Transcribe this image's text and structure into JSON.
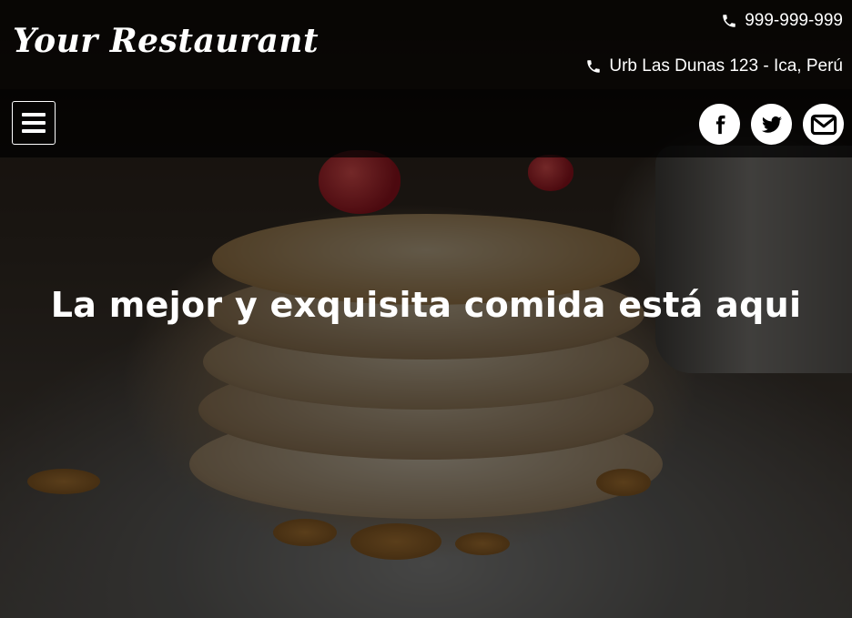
{
  "header": {
    "logo_text": "Your Restaurant",
    "phone": "999-999-999",
    "address": "Urb Las Dunas 123 - Ica, Perú",
    "phone_icon": "phone-icon"
  },
  "nav": {
    "menu_icon": "hamburger-menu-icon",
    "social": [
      {
        "name": "facebook-icon"
      },
      {
        "name": "twitter-icon"
      },
      {
        "name": "envelope-icon"
      }
    ]
  },
  "hero": {
    "headline": "La mejor y exquisita comida está aqui"
  },
  "colors": {
    "header_bg": "#000000",
    "text": "#ffffff",
    "social_bg": "#ffffff",
    "social_icon": "#000000"
  }
}
